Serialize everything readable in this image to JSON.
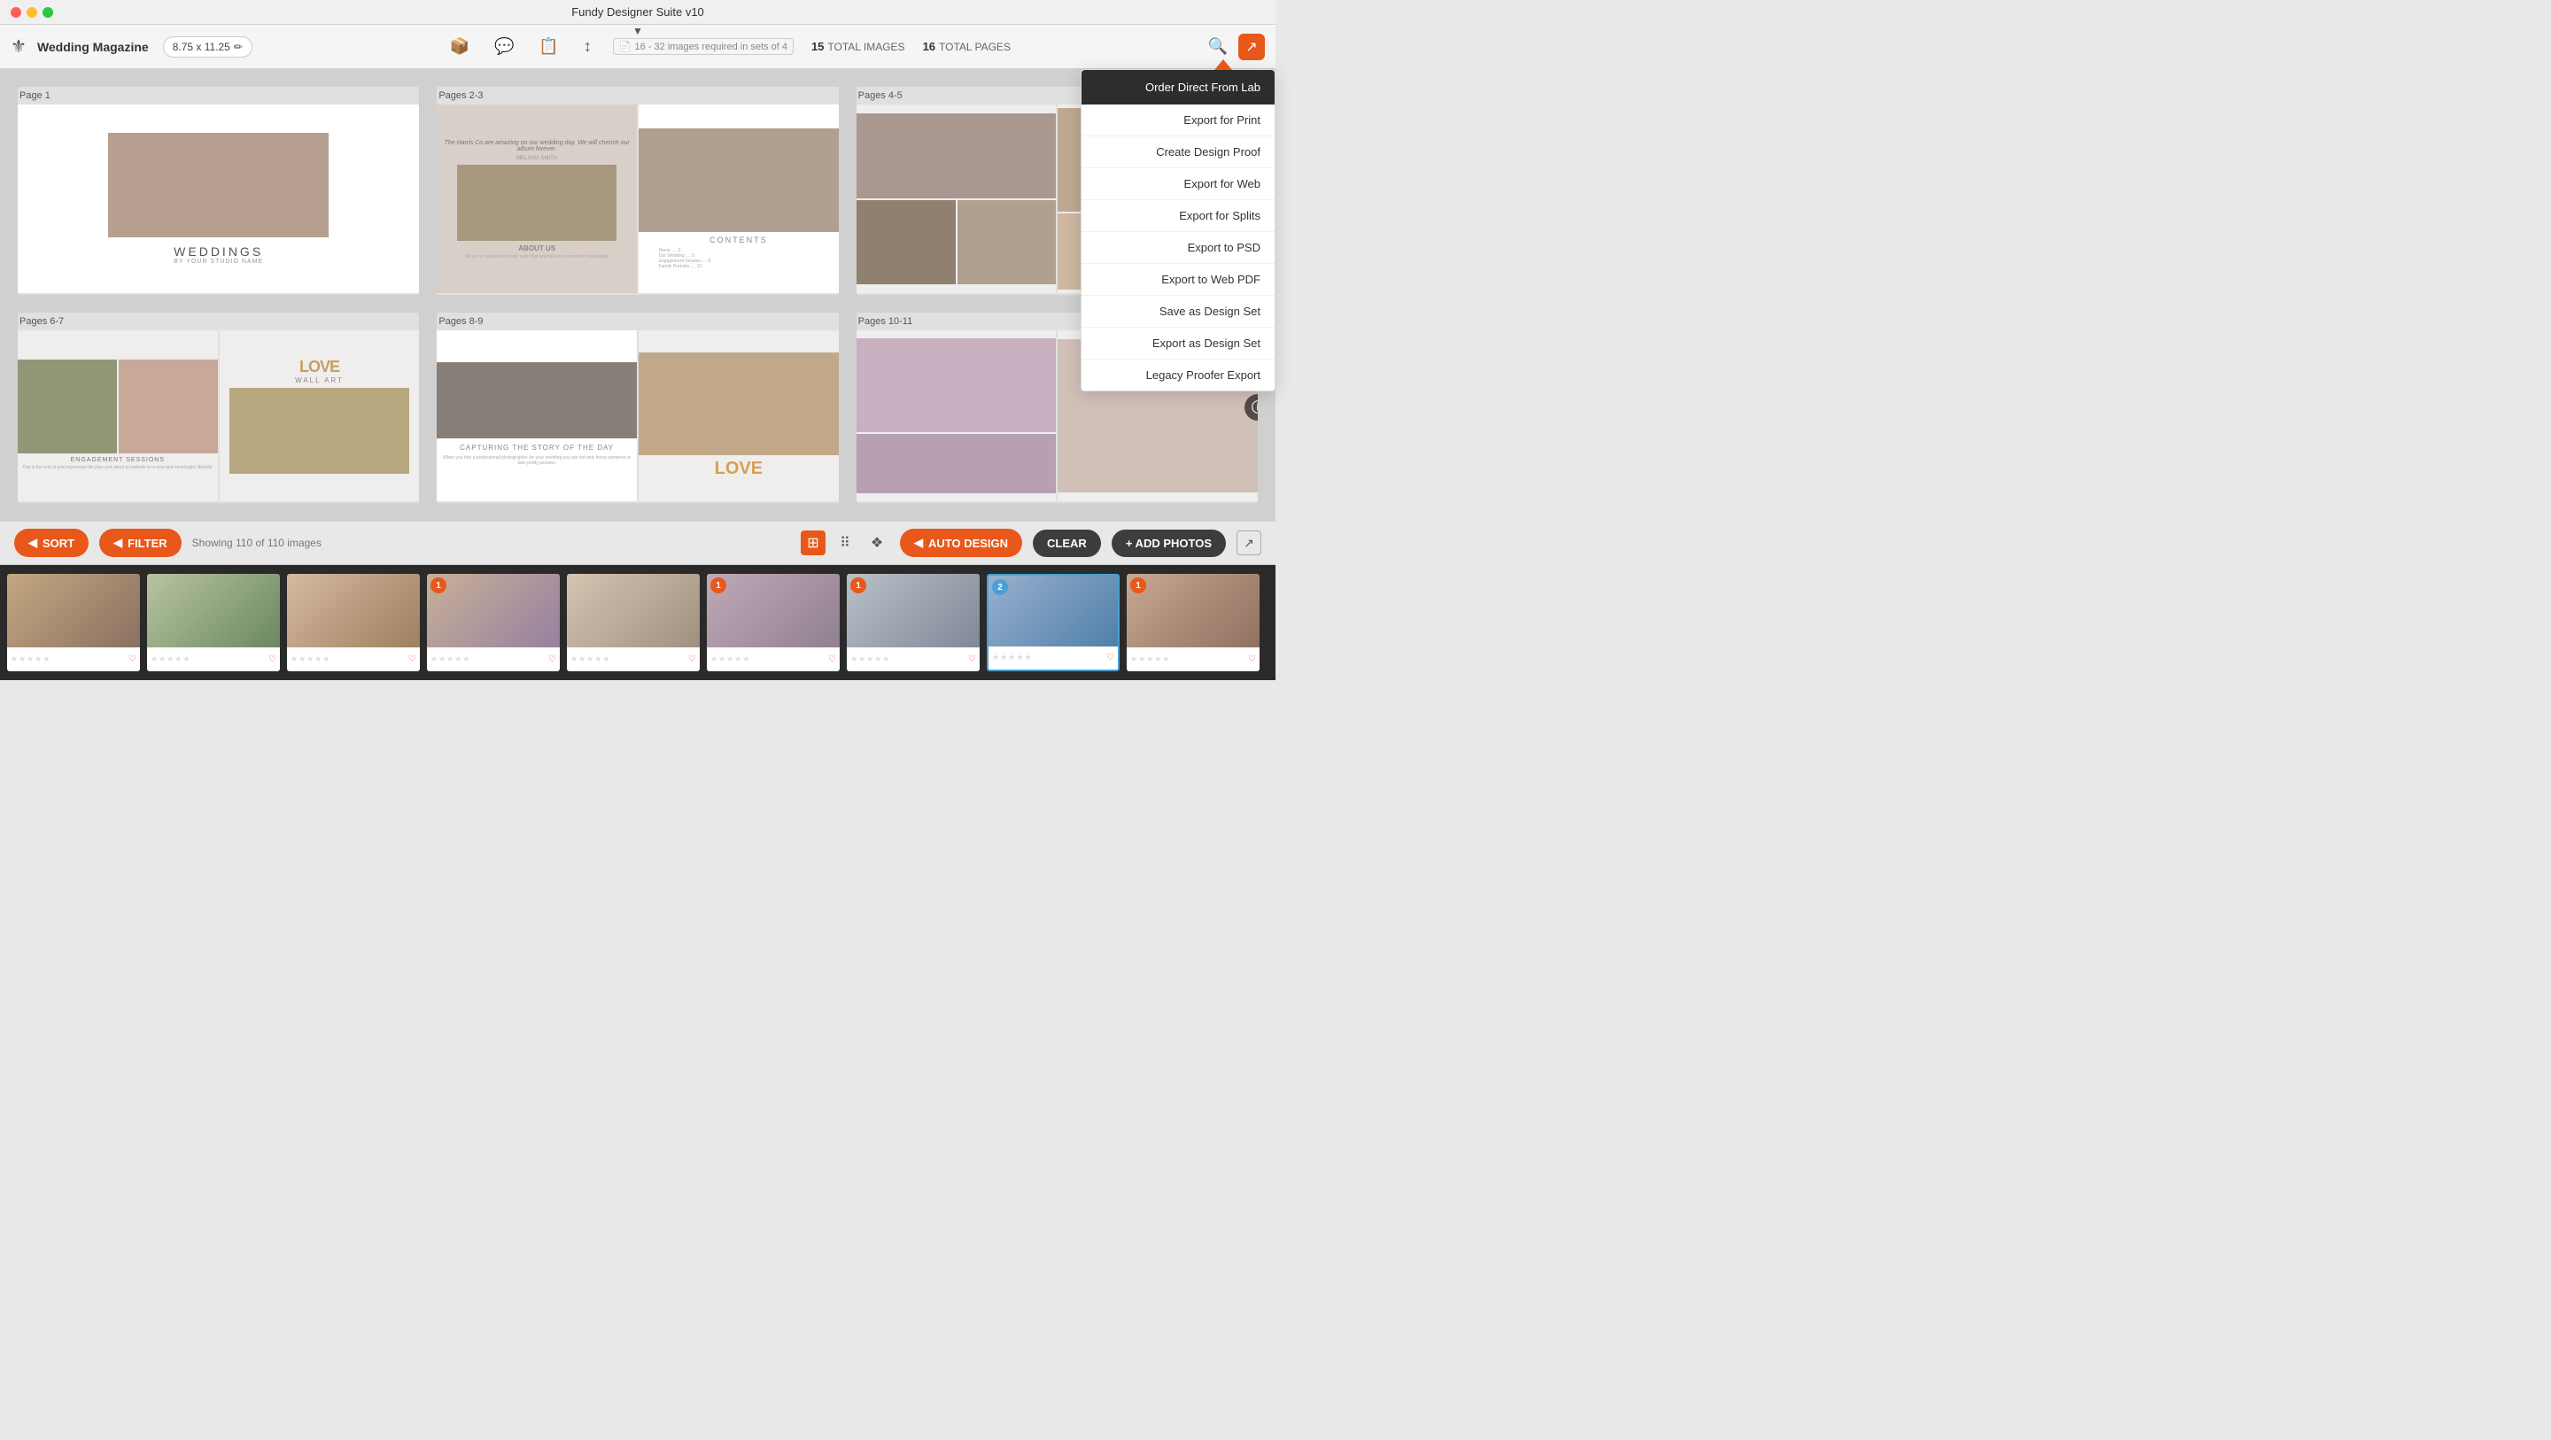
{
  "window": {
    "title": "Fundy Designer Suite v10"
  },
  "titlebar": {
    "close": "close",
    "minimize": "minimize",
    "maximize": "maximize"
  },
  "toolbar": {
    "logo": "⚜",
    "project_name": "Wedding Magazine",
    "size_label": "8.75 x 11.25",
    "edit_icon": "✏",
    "icons": [
      "📦",
      "💬",
      "📋",
      "↕"
    ],
    "requirements": "16 - 32 images required in sets of 4",
    "total_images_count": "15",
    "total_images_label": "TOTAL IMAGES",
    "total_pages_count": "16",
    "total_pages_label": "TOTAL PAGES",
    "search_icon": "🔍",
    "export_icon": "↗"
  },
  "dropdown": {
    "order_label": "Order Direct From Lab",
    "items": [
      "Export for Print",
      "Create Design Proof",
      "Export for Web",
      "Export for Splits",
      "Export to PSD",
      "Export to Web PDF",
      "Save as Design Set",
      "Export as Design Set",
      "Legacy Proofer Export"
    ]
  },
  "pages": [
    {
      "label": "Page 1",
      "type": "single"
    },
    {
      "label": "Pages 2-3",
      "type": "spread"
    },
    {
      "label": "Pages 4-5",
      "type": "spread"
    },
    {
      "label": "Pages 6-7",
      "type": "spread"
    },
    {
      "label": "Pages 8-9",
      "type": "spread"
    },
    {
      "label": "Pages 10-11",
      "type": "spread"
    }
  ],
  "bottom_toolbar": {
    "sort_label": "SORT",
    "filter_label": "FILTER",
    "showing_text": "Showing 110 of 110 images",
    "auto_design_label": "AUTO DESIGN",
    "clear_label": "CLEAR",
    "add_photos_label": "+ ADD PHOTOS"
  },
  "photos": [
    {
      "id": 1,
      "used": null,
      "color": "p1"
    },
    {
      "id": 2,
      "used": null,
      "color": "p2"
    },
    {
      "id": 3,
      "used": null,
      "color": "p3"
    },
    {
      "id": 4,
      "used": "1",
      "color": "p4"
    },
    {
      "id": 5,
      "used": null,
      "color": "p5"
    },
    {
      "id": 6,
      "used": "1",
      "color": "p6"
    },
    {
      "id": 7,
      "used": "1",
      "color": "p7"
    },
    {
      "id": 8,
      "used": "2",
      "color": "p8",
      "selected": true
    },
    {
      "id": 9,
      "used": "1",
      "color": "p9"
    }
  ]
}
